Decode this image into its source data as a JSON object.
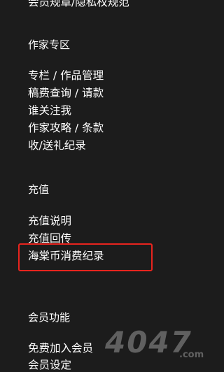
{
  "menu": {
    "top_cut_item": "会员规章/隐私权规范",
    "writer_section": {
      "heading": "作家专区",
      "items": [
        "专栏 / 作品管理",
        "稿费查询 / 请款",
        "谁关注我",
        "作家攻略 / 条款",
        "收/送礼纪录"
      ]
    },
    "recharge_section": {
      "heading": "充值",
      "items": [
        "充值说明",
        "充值回传",
        "海棠币消费纪录"
      ]
    },
    "member_section": {
      "heading": "会员功能",
      "items": [
        "免费加入会员",
        "会员设定"
      ]
    }
  },
  "highlight": {
    "target": "海棠币消费纪录",
    "color": "#e8241e"
  },
  "watermark": {
    "text": "4047",
    "domain": ".com"
  }
}
